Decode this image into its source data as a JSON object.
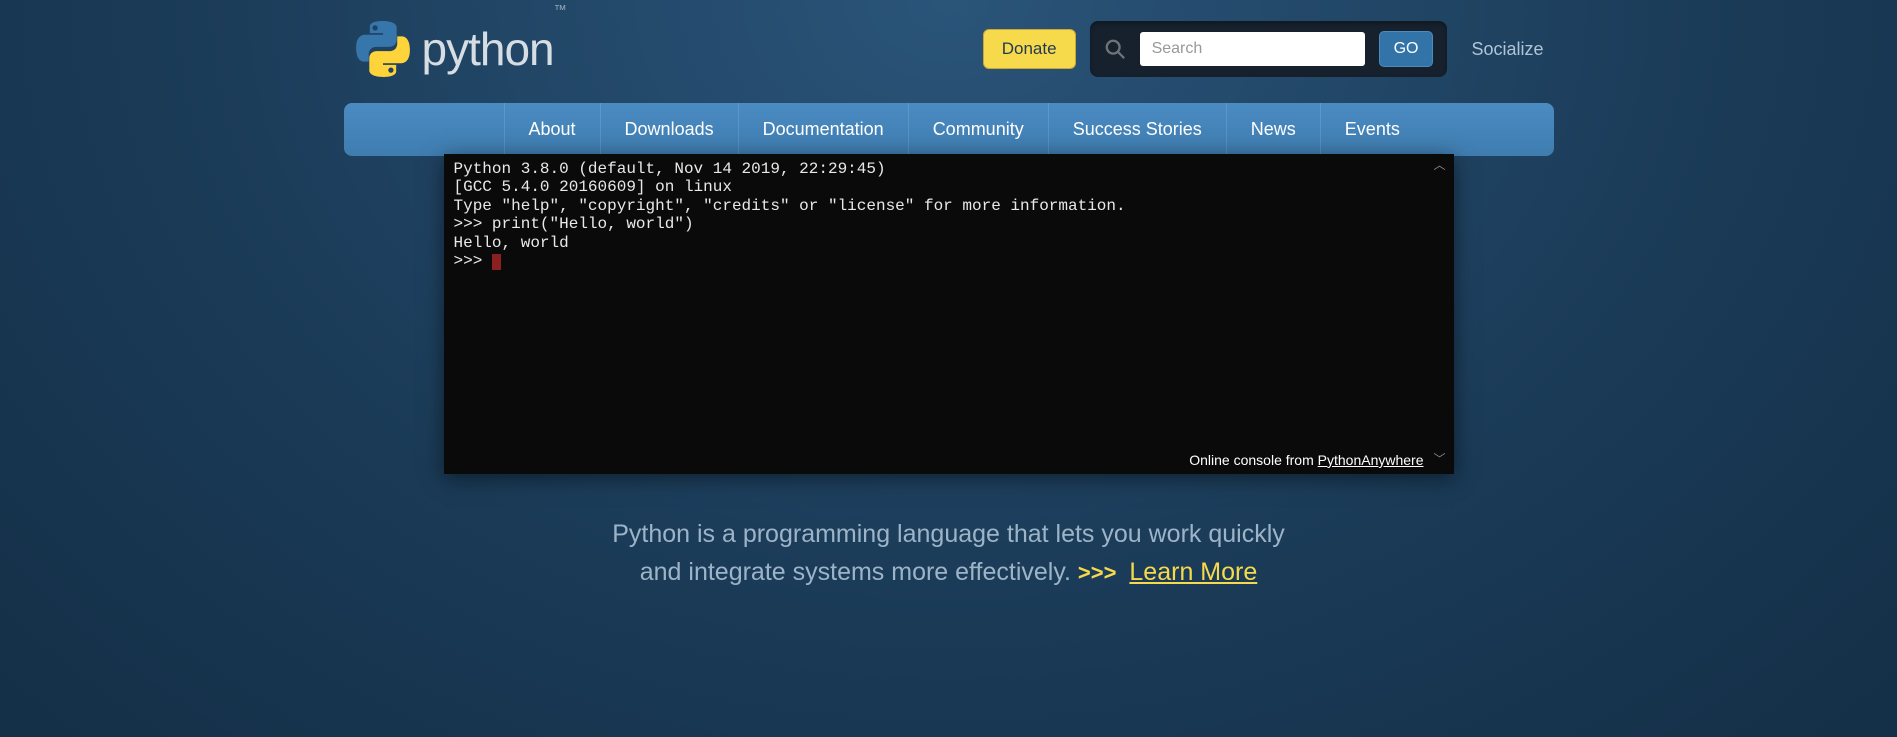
{
  "header": {
    "logo_text": "python",
    "tm": "™",
    "donate_label": "Donate",
    "search_placeholder": "Search",
    "go_label": "GO",
    "socialize_label": "Socialize"
  },
  "nav": {
    "items": [
      "About",
      "Downloads",
      "Documentation",
      "Community",
      "Success Stories",
      "News",
      "Events"
    ]
  },
  "console": {
    "lines": [
      "Python 3.8.0 (default, Nov 14 2019, 22:29:45)",
      "[GCC 5.4.0 20160609] on linux",
      "Type \"help\", \"copyright\", \"credits\" or \"license\" for more information.",
      ">>> print(\"Hello, world\")",
      "Hello, world",
      ">>> "
    ],
    "footer_prefix": "Online console from ",
    "footer_link": "PythonAnywhere"
  },
  "tagline": {
    "line1": "Python is a programming language that lets you work quickly",
    "line2_pre": "and integrate systems more effectively. ",
    "chevrons": ">>>",
    "learn_more": "Learn More"
  }
}
